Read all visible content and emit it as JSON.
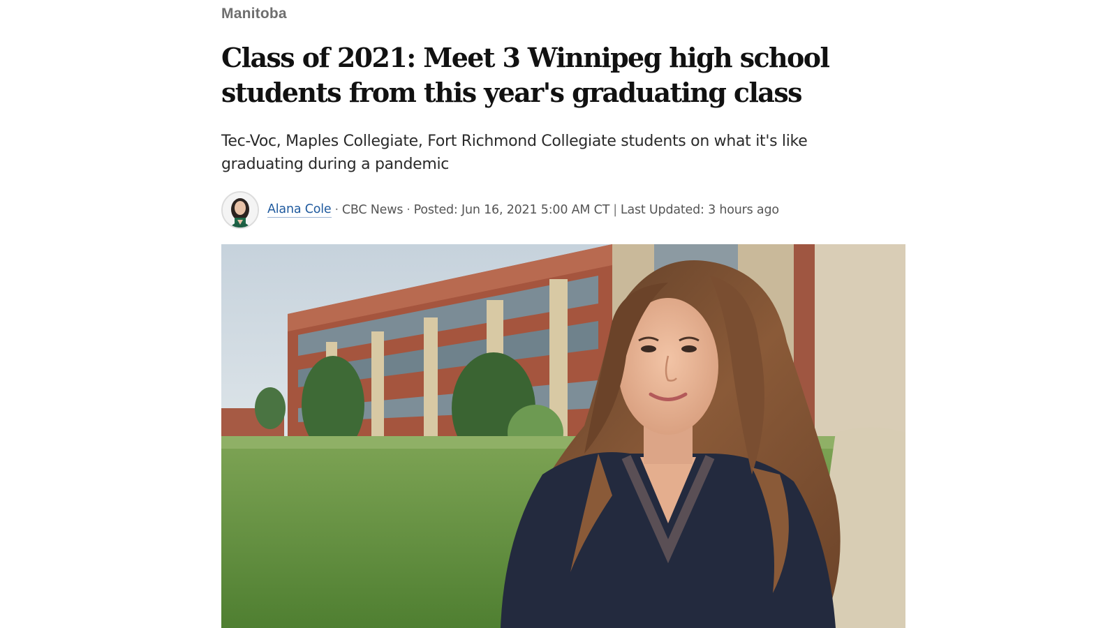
{
  "section": {
    "label": "Manitoba"
  },
  "article": {
    "headline": "Class of 2021: Meet 3 Winnipeg high school students from this year's graduating class",
    "deck": "Tec-Voc, Maples Collegiate, Fort Richmond Collegiate students on what it's like graduating during a pandemic",
    "byline": {
      "author": "Alana Cole",
      "outlet": "CBC News",
      "posted": "Posted: Jun 16, 2021 5:00 AM CT",
      "divider": "|",
      "updated": "Last Updated: 3 hours ago",
      "dot": "·"
    },
    "hero_image": {
      "subject": "student-portrait-in-front-of-school"
    }
  },
  "colors": {
    "link": "#1f5a9e",
    "section": "#6e6e6e",
    "headline": "#111111"
  }
}
